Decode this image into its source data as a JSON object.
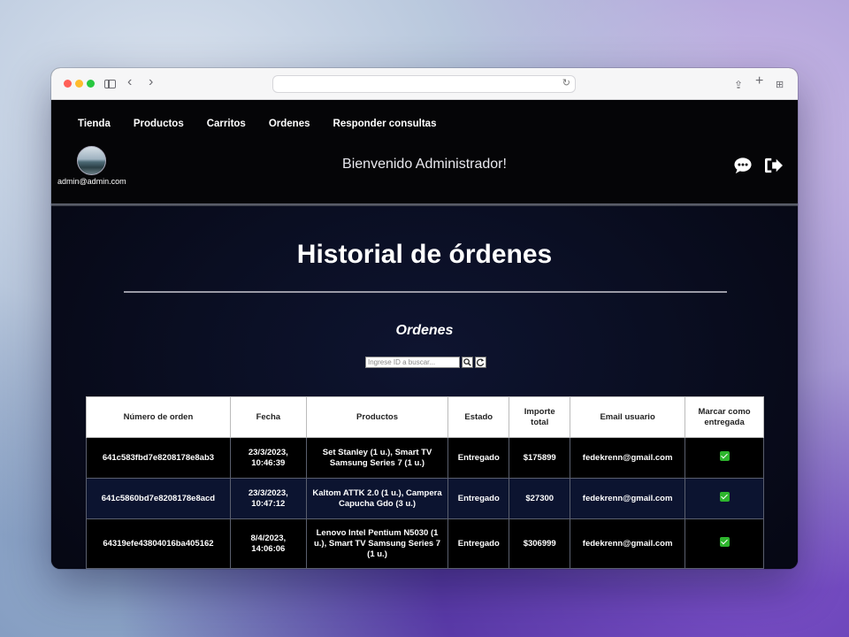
{
  "nav": {
    "links": [
      "Tienda",
      "Productos",
      "Carritos",
      "Ordenes",
      "Responder consultas"
    ]
  },
  "user": {
    "email": "admin@admin.com"
  },
  "header": {
    "welcome": "Bienvenido Administrador!"
  },
  "main": {
    "title": "Historial de órdenes",
    "section_title": "Ordenes",
    "search": {
      "placeholder": "Ingrese ID a buscar..."
    }
  },
  "table": {
    "headers": [
      "Número de orden",
      "Fecha",
      "Productos",
      "Estado",
      "Importe total",
      "Email usuario",
      "Marcar como entregada"
    ],
    "rows": [
      {
        "id": "641c583fbd7e8208178e8ab3",
        "date": "23/3/2023, 10:46:39",
        "products": "Set Stanley (1 u.), Smart TV Samsung Series 7 (1 u.)",
        "status": "Entregado",
        "total": "$175899",
        "email": "fedekrenn@gmail.com",
        "delivered": true
      },
      {
        "id": "641c5860bd7e8208178e8acd",
        "date": "23/3/2023, 10:47:12",
        "products": "Kaltom ATTK 2.0 (1 u.), Campera Capucha Gdo (3 u.)",
        "status": "Entregado",
        "total": "$27300",
        "email": "fedekrenn@gmail.com",
        "delivered": true
      },
      {
        "id": "64319efe43804016ba405162",
        "date": "8/4/2023, 14:06:06",
        "products": "Lenovo Intel Pentium N5030 (1 u.), Smart TV Samsung Series 7 (1 u.)",
        "status": "Entregado",
        "total": "$306999",
        "email": "fedekrenn@gmail.com",
        "delivered": true
      }
    ]
  },
  "icons": {
    "chat": "chat-bubble-icon",
    "logout": "logout-icon",
    "search": "search-icon",
    "refresh": "refresh-icon",
    "check": "checkbox-checked-icon"
  },
  "colors": {
    "check_green": "#2db52d",
    "page_bg": "#0a0e22"
  }
}
